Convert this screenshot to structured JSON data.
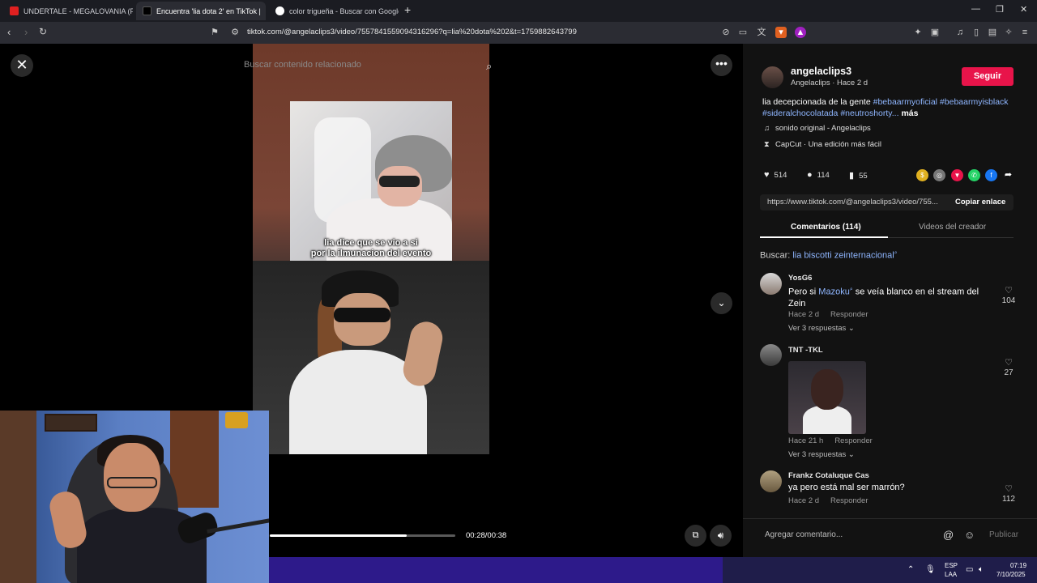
{
  "browser": {
    "tabs": [
      {
        "title": "UNDERTALE - MEGALOVANIA (Pegbc",
        "favicon_color": "#e02020"
      },
      {
        "title": "Encuentra 'lia dota 2' en TikTok |",
        "favicon_color": "#000000"
      },
      {
        "title": "color trigueña - Buscar con Google",
        "favicon_color": "#4285f4"
      }
    ],
    "new_tab": "+",
    "url": "tiktok.com/@angelaclips3/video/7557841559094316296?q=lia%20dota%202&t=1759882643799",
    "window_controls": {
      "minimize": "—",
      "maximize": "❐",
      "close": "✕"
    }
  },
  "player": {
    "search_placeholder": "Buscar contenido relacionado",
    "subtitle_line1": "lia dice que se vio a si",
    "subtitle_line2": "por la ilmunacion del evento",
    "time": "00:28/00:38",
    "progress": 0.74,
    "close_glyph": "✕",
    "more_glyph": "•••",
    "down_glyph": "⌄"
  },
  "post": {
    "username": "angelaclips3",
    "subline": "Angelaclips · Hace 2 d",
    "follow_label": "Seguir",
    "desc_text": "lia decepcionada de la gente ",
    "desc_tags": [
      "#bebaarmyoficial",
      "#bebaarmyisblack",
      "#sideralchocolatada",
      "#neutroshorty..."
    ],
    "desc_more": "más",
    "sound": "sonido original - Angelaclips",
    "capcut": "CapCut · Una edición más fácil",
    "likes": "514",
    "comments": "114",
    "saves": "55",
    "link": "https://www.tiktok.com/@angelaclips3/video/755...",
    "copy_label": "Copiar enlace",
    "tab_comments": "Comentarios (114)",
    "tab_creator": "Videos del creador",
    "search_prefix": "Buscar:",
    "search_query": "lia biscotti zeinternacional"
  },
  "comments": [
    {
      "name": "YosG6",
      "text_before": "Pero si ",
      "text_link": "Mazoku",
      "text_after": " se veía blanco en el stream del Zein",
      "time": "Hace 2 d",
      "reply": "Responder",
      "replies": "Ver 3 respuestas ⌄",
      "likes": "104"
    },
    {
      "name": "TNT -TKL",
      "time": "Hace 21 h",
      "reply": "Responder",
      "replies": "Ver 3 respuestas ⌄",
      "likes": "27"
    },
    {
      "name": "Frankz Cotaluque Cas",
      "text": "ya pero está mal ser marrón?",
      "time": "Hace 2 d",
      "reply": "Responder",
      "likes": "112"
    }
  ],
  "compose": {
    "placeholder": "Agregar comentario...",
    "post_label": "Publicar"
  },
  "taskbar": {
    "lang1": "ESP",
    "lang2": "LAA",
    "clock_time": "07:19",
    "clock_date": "7/10/2025"
  },
  "colors": {
    "accent": "#e8144a",
    "tag": "#8fb6ff"
  }
}
